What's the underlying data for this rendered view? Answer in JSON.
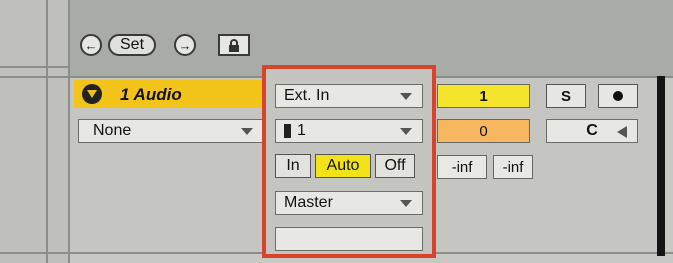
{
  "transport": {
    "prev_icon": "arrow-left-icon",
    "set_label": "Set",
    "next_icon": "arrow-right-icon",
    "lock_icon": "lock-icon"
  },
  "track": {
    "expand_icon": "chevron-down-icon",
    "name": "1 Audio",
    "number_value": "1",
    "solo_label": "S",
    "arm_icon": "record-icon",
    "send_value": "0",
    "pan_label": "C",
    "pan_icon": "pan-left-arrow-icon",
    "inputs_dropdown": {
      "value": "None"
    },
    "meter_left": "-inf",
    "meter_right": "-inf"
  },
  "routing": {
    "input_type": "Ext. In",
    "input_channel": "1",
    "monitor": {
      "in_label": "In",
      "auto_label": "Auto",
      "off_label": "Off",
      "active": "Auto"
    },
    "output": "Master",
    "output_channel": ""
  },
  "colors": {
    "title_bar": "#f2c318",
    "highlight_border": "#d8442b",
    "active_monitor": "#f1e318",
    "track_number_bg": "#f4e42b",
    "send_bg": "#f6b760"
  }
}
